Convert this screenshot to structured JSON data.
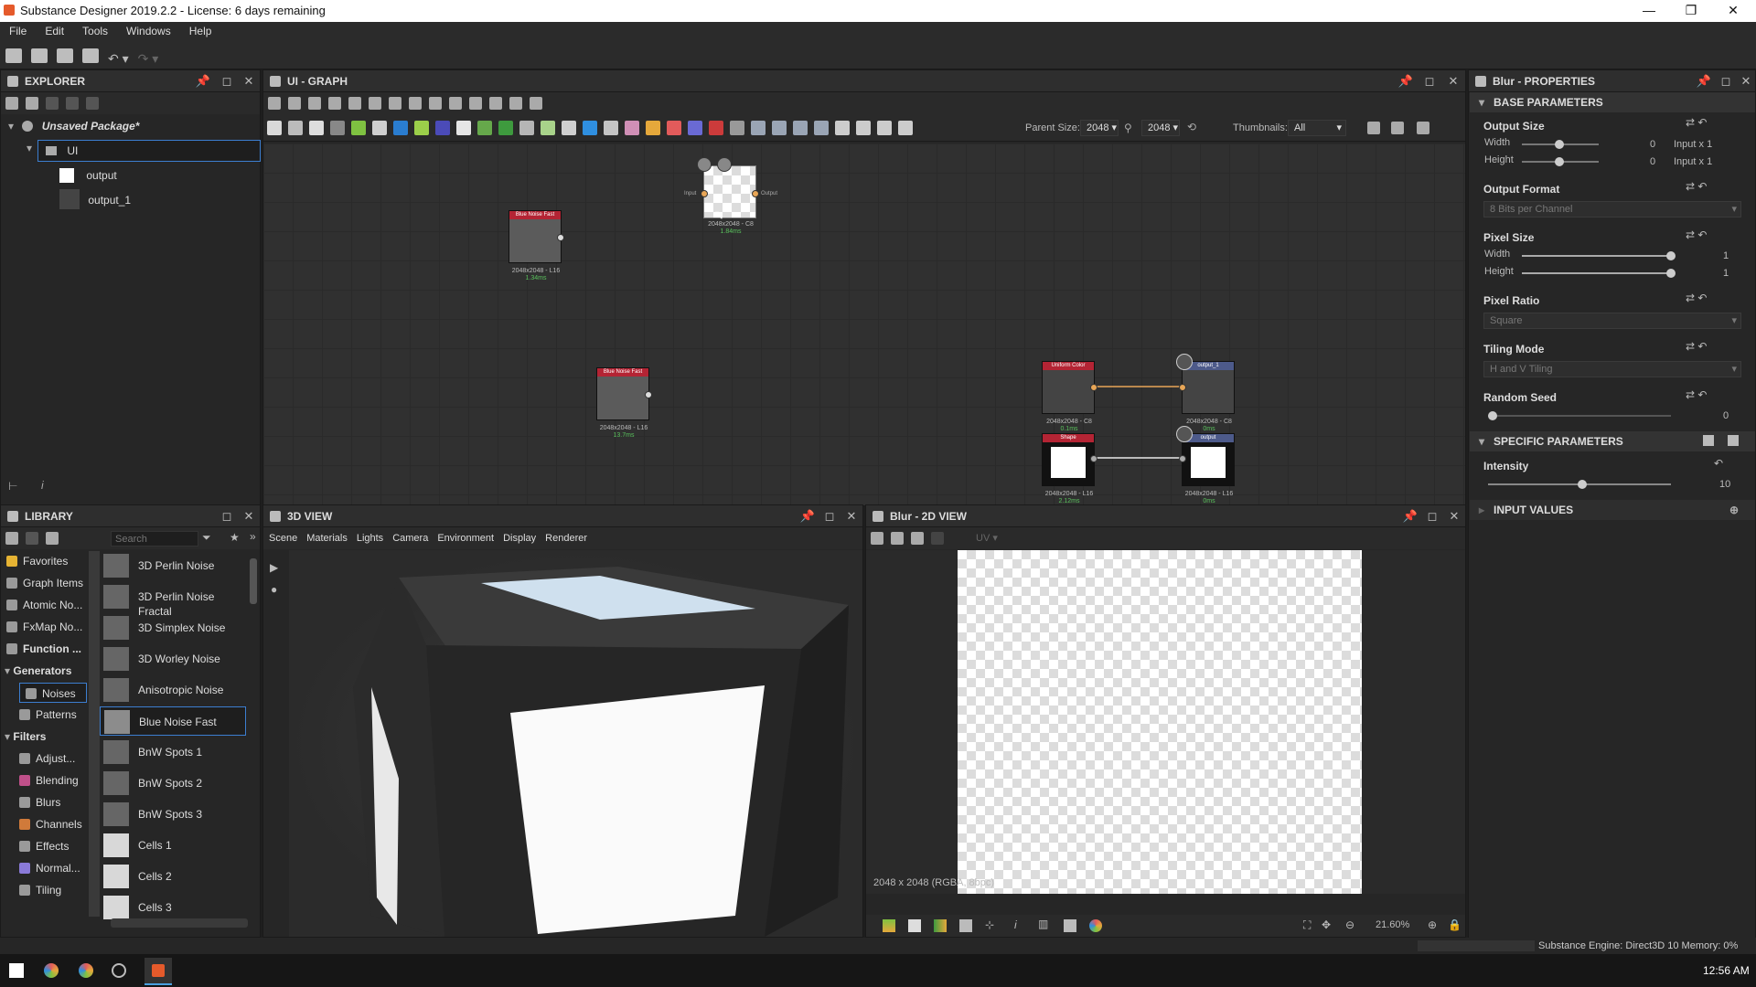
{
  "window": {
    "title": "Substance Designer 2019.2.2 - License: 6 days remaining",
    "minimize": "—",
    "maximize": "❐",
    "close": "✕"
  },
  "menu": [
    "File",
    "Edit",
    "Tools",
    "Windows",
    "Help"
  ],
  "explorer": {
    "title": "EXPLORER",
    "package": "Unsaved Package*",
    "graph": "UI",
    "items": [
      "output",
      "output_1"
    ]
  },
  "graph": {
    "title": "UI - GRAPH",
    "parent_size_label": "Parent Size:",
    "parent_size": "2048",
    "size2": "2048",
    "thumbnails_label": "Thumbnails:",
    "thumbnails": "All",
    "nodes": [
      {
        "header": "Blue Noise Fast",
        "res": "2048x2048 - L16",
        "time": "1.34ms"
      },
      {
        "header": "",
        "res": "2048x2048 - C8",
        "time": "1.84ms",
        "in": "Input",
        "out": "Output"
      },
      {
        "header": "Blue Noise Fast",
        "res": "2048x2048 - L16",
        "time": "13.7ms"
      },
      {
        "header": "Shape",
        "res": "2048x2048 - L16",
        "time": "2.12ms"
      },
      {
        "header": "output",
        "res": "2048x2048 - L16",
        "time": "0ms"
      },
      {
        "header": "Uniform Color",
        "res": "2048x2048 - C8",
        "time": "0.1ms"
      },
      {
        "header": "output_1",
        "res": "2048x2048 - C8",
        "time": "0ms"
      }
    ]
  },
  "library": {
    "title": "LIBRARY",
    "search_placeholder": "Search",
    "categories": [
      {
        "label": "Favorites",
        "icon": "star-icon",
        "color": "#e6b333",
        "bold": false
      },
      {
        "label": "Graph Items",
        "icon": "graph-items-icon",
        "color": "#9a9a9a",
        "bold": false
      },
      {
        "label": "Atomic No...",
        "icon": "atomic-icon",
        "color": "#9a9a9a",
        "bold": false
      },
      {
        "label": "FxMap No...",
        "icon": "fxmap-icon",
        "color": "#9a9a9a",
        "bold": false
      },
      {
        "label": "Function ...",
        "icon": "function-icon",
        "color": "#9a9a9a",
        "bold": true
      },
      {
        "label": "Generators",
        "icon": "",
        "color": "",
        "bold": true
      },
      {
        "label": "Noises",
        "icon": "noise-icon",
        "color": "#9a9a9a",
        "bold": false
      },
      {
        "label": "Patterns",
        "icon": "pattern-icon",
        "color": "#9a9a9a",
        "bold": false
      },
      {
        "label": "Filters",
        "icon": "",
        "color": "",
        "bold": true
      },
      {
        "label": "Adjust...",
        "icon": "adjust-icon",
        "color": "#9a9a9a",
        "bold": false
      },
      {
        "label": "Blending",
        "icon": "blending-icon",
        "color": "#c0508a",
        "bold": false
      },
      {
        "label": "Blurs",
        "icon": "blur-icon",
        "color": "#9a9a9a",
        "bold": false
      },
      {
        "label": "Channels",
        "icon": "channels-icon",
        "color": "#d07a3a",
        "bold": false
      },
      {
        "label": "Effects",
        "icon": "effects-icon",
        "color": "#9a9a9a",
        "bold": false
      },
      {
        "label": "Normal...",
        "icon": "normal-icon",
        "color": "#8a7ad8",
        "bold": false
      },
      {
        "label": "Tiling",
        "icon": "tiling-icon",
        "color": "#9a9a9a",
        "bold": false
      }
    ],
    "items": [
      "3D Perlin Noise",
      "3D Perlin Noise Fractal",
      "3D Simplex Noise",
      "3D Worley Noise",
      "Anisotropic Noise",
      "Blue Noise Fast",
      "BnW Spots 1",
      "BnW Spots 2",
      "BnW Spots 3",
      "Cells 1",
      "Cells 2",
      "Cells 3"
    ],
    "selected_item": "Blue Noise Fast"
  },
  "view3d": {
    "title": "3D VIEW",
    "menu": [
      "Scene",
      "Materials",
      "Lights",
      "Camera",
      "Environment",
      "Display",
      "Renderer"
    ]
  },
  "view2d": {
    "title": "Blur - 2D VIEW",
    "uv": "UV",
    "info": "2048 x 2048 (RGBA, 8bpc)",
    "zoom": "21.60%"
  },
  "properties": {
    "title": "Blur - PROPERTIES",
    "base_section": "BASE PARAMETERS",
    "output_size": {
      "label": "Output Size",
      "width_label": "Width",
      "height_label": "Height",
      "width_value": "0",
      "height_value": "0",
      "width_mode": "Input x 1",
      "height_mode": "Input x 1"
    },
    "output_format": {
      "label": "Output Format",
      "value": "8 Bits per Channel"
    },
    "pixel_size": {
      "label": "Pixel Size",
      "width_label": "Width",
      "height_label": "Height",
      "width_value": "1",
      "height_value": "1"
    },
    "pixel_ratio": {
      "label": "Pixel Ratio",
      "value": "Square"
    },
    "tiling_mode": {
      "label": "Tiling Mode",
      "value": "H and V Tiling"
    },
    "random_seed": {
      "label": "Random Seed",
      "value": "0"
    },
    "specific_section": "SPECIFIC PARAMETERS",
    "intensity": {
      "label": "Intensity",
      "value": "10"
    },
    "input_section": "INPUT VALUES"
  },
  "status": {
    "engine": "Substance Engine: Direct3D 10  Memory: 0%"
  },
  "taskbar": {
    "time": "12:56 AM"
  }
}
